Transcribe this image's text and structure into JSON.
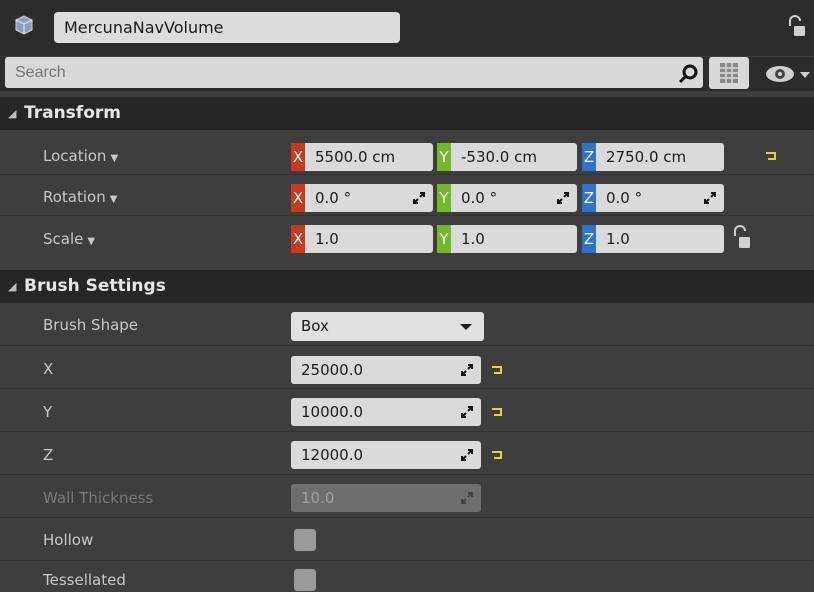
{
  "header": {
    "actor_icon": "cube-volume-icon",
    "name": "MercunaNavVolume",
    "lock_icon": "padlock-icon"
  },
  "search": {
    "placeholder": "Search",
    "search_icon": "magnifier-icon",
    "grid_icon": "property-matrix-icon",
    "eye_icon": "eye-icon"
  },
  "transform": {
    "title": "Transform",
    "rows": [
      {
        "label": "Location",
        "x": "5500.0 cm",
        "y": "-530.0 cm",
        "z": "2750.0 cm"
      },
      {
        "label": "Rotation",
        "x": "0.0 °",
        "y": "0.0 °",
        "z": "0.0 °"
      },
      {
        "label": "Scale",
        "x": "1.0",
        "y": "1.0",
        "z": "1.0"
      }
    ],
    "axis_labels": {
      "x": "X",
      "y": "Y",
      "z": "Z"
    }
  },
  "brush": {
    "title": "Brush Settings",
    "shape_label": "Brush Shape",
    "shape_value": "Box",
    "x_label": "X",
    "x_value": "25000.0",
    "y_label": "Y",
    "y_value": "10000.0",
    "z_label": "Z",
    "z_value": "12000.0",
    "wall_label": "Wall Thickness",
    "wall_value": "10.0",
    "hollow_label": "Hollow",
    "tess_label": "Tessellated"
  },
  "colors": {
    "axis_x": "#c73a1d",
    "axis_y": "#74b82a",
    "axis_z": "#2d74cf",
    "reset_arrow": "#e5d33a"
  }
}
